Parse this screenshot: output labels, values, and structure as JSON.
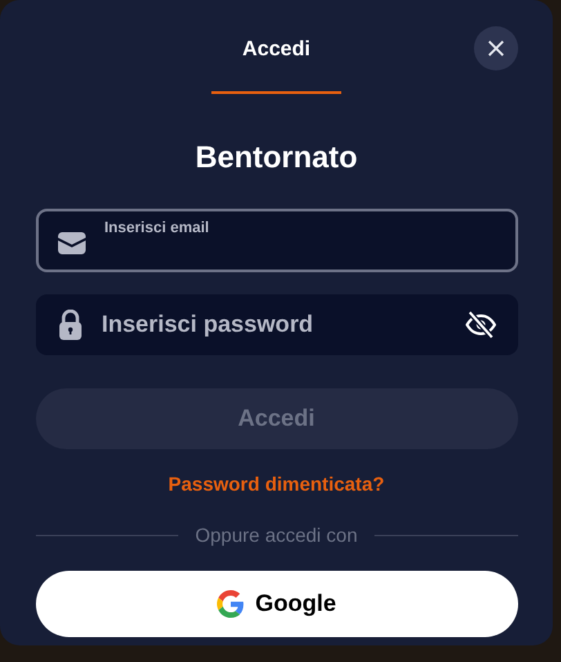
{
  "tabs": [
    {
      "label": "Accedi",
      "selected": true
    }
  ],
  "title": "Bentornato",
  "email_field": {
    "placeholder": "Inserisci email",
    "focused": true
  },
  "password_field": {
    "placeholder": "Inserisci password",
    "password_visible": false
  },
  "submit_button": {
    "label": "Accedi",
    "disabled": true
  },
  "forgot_link": "Password dimenticata?",
  "divider_text": "Oppure accedi con",
  "google_button": {
    "label": "Google"
  }
}
